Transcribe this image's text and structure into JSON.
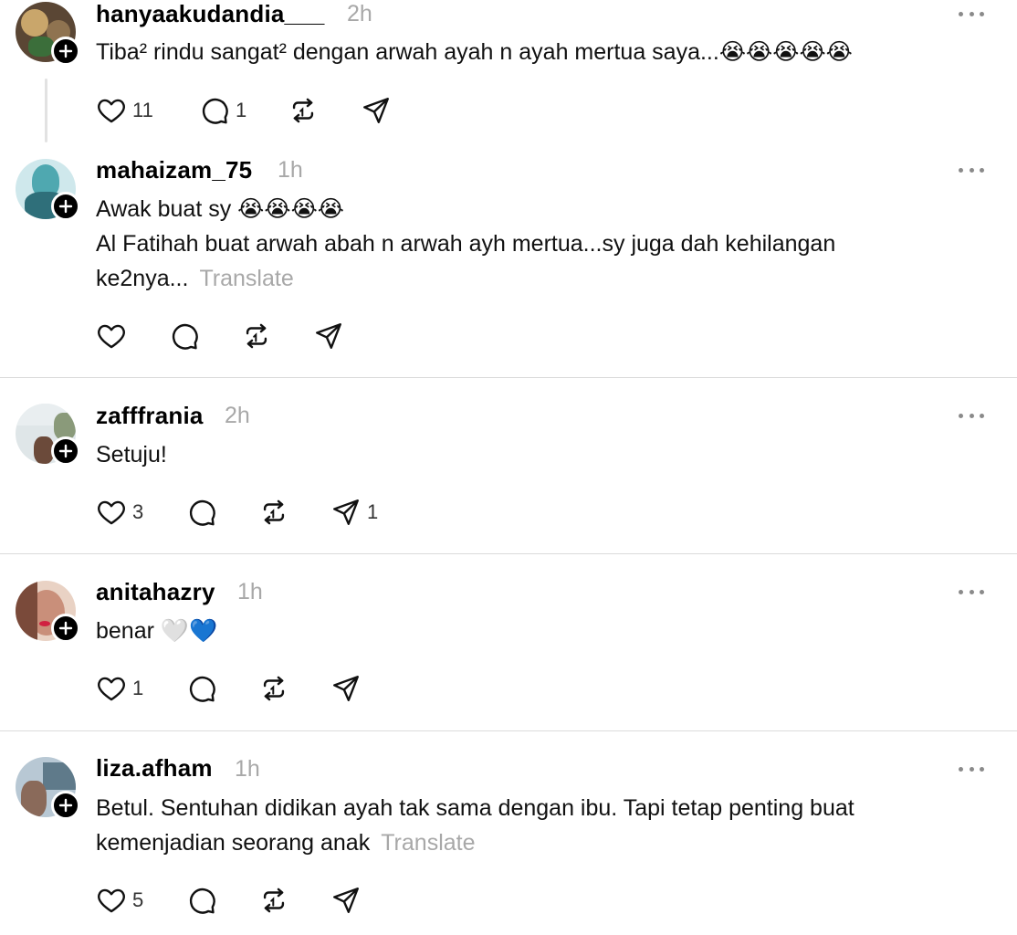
{
  "posts": [
    {
      "username": "hanyaakudandia___",
      "time": "2h",
      "lines": [
        "Tiba² rindu sangat² dengan arwah ayah n ayah mertua saya...😭😭😭😭😭"
      ],
      "translate": "",
      "likes": "11",
      "replies": "1",
      "reposts": "",
      "shares": "",
      "avatar_colors": [
        "#5a4634",
        "#8f7350",
        "#c9a66b"
      ]
    },
    {
      "username": "mahaizam_75",
      "time": "1h",
      "lines": [
        "Awak buat sy 😭😭😭😭",
        "Al Fatihah buat arwah abah n arwah ayh mertua...sy juga dah kehilangan",
        "ke2nya..."
      ],
      "translate": "Translate",
      "likes": "",
      "replies": "",
      "reposts": "",
      "shares": "",
      "avatar_colors": [
        "#cfe8ec",
        "#4fa8b0",
        "#2f6f7a"
      ]
    },
    {
      "username": "zafffrania",
      "time": "2h",
      "lines": [
        "Setuju!"
      ],
      "translate": "",
      "likes": "3",
      "replies": "",
      "reposts": "",
      "shares": "1",
      "avatar_colors": [
        "#dfe6e8",
        "#8a9a7a",
        "#6b4a3a"
      ]
    },
    {
      "username": "anitahazry",
      "time": "1h",
      "lines": [
        "benar 🤍💙"
      ],
      "translate": "",
      "likes": "1",
      "replies": "",
      "reposts": "",
      "shares": "",
      "avatar_colors": [
        "#e9d2c4",
        "#c98f7a",
        "#7a4a3a"
      ]
    },
    {
      "username": "liza.afham",
      "time": "1h",
      "lines": [
        "Betul. Sentuhan didikan ayah tak sama dengan ibu. Tapi tetap penting buat",
        "kemenjadian seorang anak"
      ],
      "translate": "Translate",
      "likes": "5",
      "replies": "",
      "reposts": "",
      "shares": "",
      "avatar_colors": [
        "#b8c8d4",
        "#5f7a8a",
        "#8a6a5a"
      ]
    }
  ],
  "icons": {
    "like": "heart-icon",
    "reply": "comment-icon",
    "repost": "repost-icon",
    "share": "send-icon",
    "more": "more-options-icon",
    "follow": "plus-icon"
  }
}
